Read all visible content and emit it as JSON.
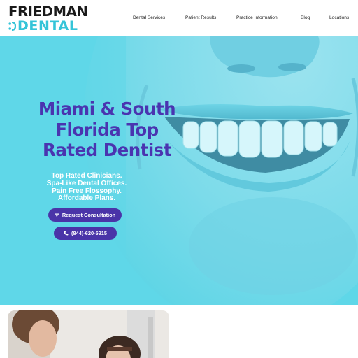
{
  "header": {
    "logo": {
      "line1": "FRIEDMAN",
      "line2": "DENTAL",
      "mark_icon": "brand-dots-icon",
      "accent_color": "#35c4d8"
    },
    "nav": [
      {
        "label": "Dental Services"
      },
      {
        "label": "Patient Results"
      },
      {
        "label": "Practice Information"
      },
      {
        "label": "Blog"
      },
      {
        "label": "Locations"
      }
    ]
  },
  "hero": {
    "title": "Miami & South Florida Top Rated Dentist",
    "subtitle_lines": [
      "Top Rated Clinicians.",
      "Spa-Like Dental Offices.",
      "Pain Free Flossophy.",
      "Affordable Plans."
    ],
    "consult_button": {
      "label": "Request Consultation",
      "icon": "calendar-check-icon"
    },
    "phone_button": {
      "label": "(844)-620-5915",
      "icon": "phone-icon"
    },
    "colors": {
      "overlay": "#5fd7e8",
      "title": "#4a34b0",
      "button": "#4a34a8"
    }
  }
}
